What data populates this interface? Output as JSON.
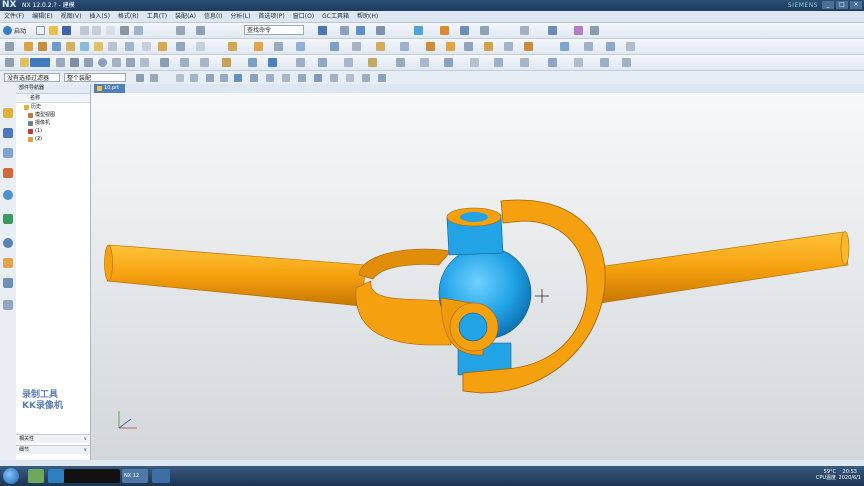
{
  "window": {
    "logo": "NX",
    "title": "NX 12.0.2.? - 建模",
    "brand": "SIEMENS",
    "controls": [
      "_",
      "□",
      "×"
    ]
  },
  "menu": [
    "文件(F)",
    "编辑(E)",
    "视图(V)",
    "插入(S)",
    "格式(R)",
    "工具(T)",
    "装配(A)",
    "信息(I)",
    "分析(L)",
    "首选项(P)",
    "窗口(O)",
    "GC工具箱",
    "帮助(H)"
  ],
  "toolbar": {
    "start_label": "启动",
    "command_search_placeholder": "查找命令"
  },
  "filterbar": {
    "selection_filter": "没有选择过滤器",
    "scope": "整个装配"
  },
  "navigator": {
    "header": "部件导航器",
    "column_header": "名称",
    "items": [
      {
        "label": "历史",
        "icon": "history-icon",
        "level": 0
      },
      {
        "label": "模型视图",
        "icon": "model-views-icon",
        "level": 1
      },
      {
        "label": "摄像机",
        "icon": "camera-icon",
        "level": 1
      },
      {
        "label": "(1)",
        "icon": "feature-icon",
        "level": 1
      },
      {
        "label": "(2)",
        "icon": "feature-icon",
        "level": 1
      }
    ],
    "bottom_panels": [
      "相关性",
      "细节"
    ]
  },
  "tab": {
    "label": "10.prt"
  },
  "watermark": {
    "line1": "录制工具",
    "line2": "KK录像机"
  },
  "taskbar": {
    "active_item": "NX 12",
    "weather": "59°C",
    "weather_sub": "CPU温度",
    "time": "20:53",
    "date": "2020/6/1"
  },
  "colors": {
    "part_orange": "#f5a10f",
    "part_orange_shade": "#d47f00",
    "cross_blue": "#21a3e6",
    "viewport_top": "#f7f8f9",
    "viewport_bottom": "#d3d7da"
  }
}
